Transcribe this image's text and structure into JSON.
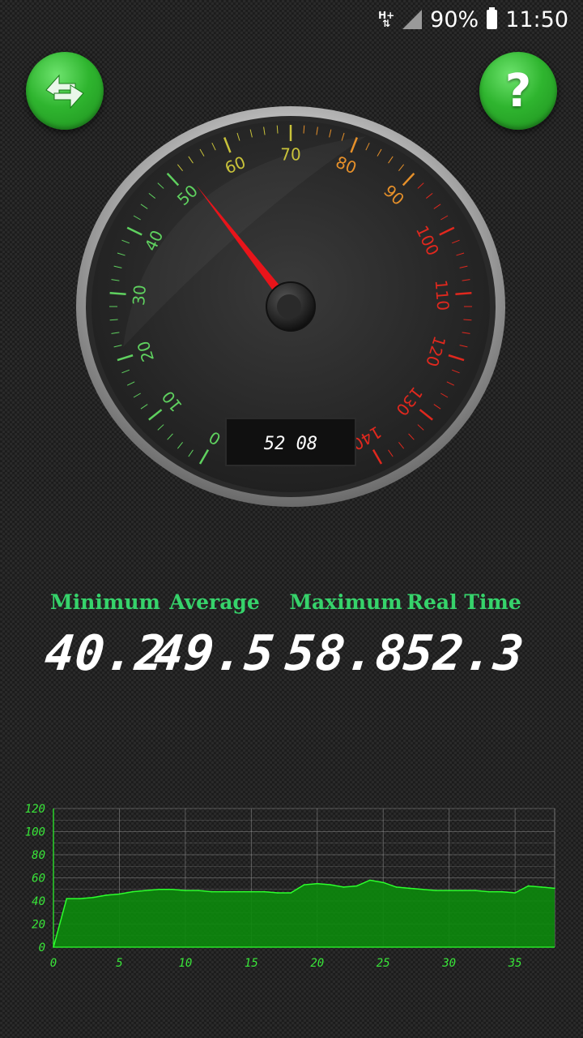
{
  "status_bar": {
    "network": "H+",
    "battery": "90%",
    "time": "11:50"
  },
  "buttons": {
    "refresh_icon": "refresh-arrows-icon",
    "help_label": "?"
  },
  "speedometer": {
    "min": 0,
    "max": 140,
    "needle_value": 52.3,
    "tick_labels": [
      "0",
      "10",
      "20",
      "30",
      "40",
      "50",
      "60",
      "70",
      "80",
      "90",
      "100",
      "110",
      "120",
      "130",
      "140"
    ],
    "digital_readout": "52 08",
    "colors": {
      "green": "#5fd15f",
      "yellow": "#c8c23a",
      "orange": "#e6902a",
      "red": "#e0281e",
      "needle": "#e8141a"
    }
  },
  "stats": {
    "minimum_label": "Minimum",
    "minimum_value": "40.2",
    "average_label": "Average",
    "average_value": "49.5",
    "maximum_label": "Maximum",
    "maximum_value": "58.8",
    "realtime_label": "Real Time",
    "realtime_value": "52.3"
  },
  "chart_data": {
    "type": "area",
    "x": [
      0,
      1,
      2,
      3,
      4,
      5,
      6,
      7,
      8,
      9,
      10,
      11,
      12,
      13,
      14,
      15,
      16,
      17,
      18,
      19,
      20,
      21,
      22,
      23,
      24,
      25,
      26,
      27,
      28,
      29,
      30,
      31,
      32,
      33,
      34,
      35,
      36,
      37,
      38
    ],
    "values": [
      0,
      42,
      42,
      43,
      45,
      46,
      48,
      49,
      50,
      50,
      49,
      49,
      48,
      48,
      48,
      48,
      48,
      47,
      47,
      54,
      55,
      54,
      52,
      53,
      58,
      56,
      52,
      51,
      50,
      49,
      49,
      49,
      49,
      48,
      48,
      47,
      53,
      52,
      51
    ],
    "xlim": [
      0,
      38
    ],
    "ylim": [
      0,
      120
    ],
    "x_ticks": [
      "0",
      "5",
      "10",
      "15",
      "20",
      "25",
      "30",
      "35"
    ],
    "y_ticks": [
      "0",
      "20",
      "40",
      "60",
      "80",
      "100",
      "120"
    ],
    "grid": true,
    "colors": {
      "fill": "#0c8a0c",
      "line": "#2cff2c",
      "labels": "#39e639",
      "grid": "#8a8a8a"
    }
  }
}
